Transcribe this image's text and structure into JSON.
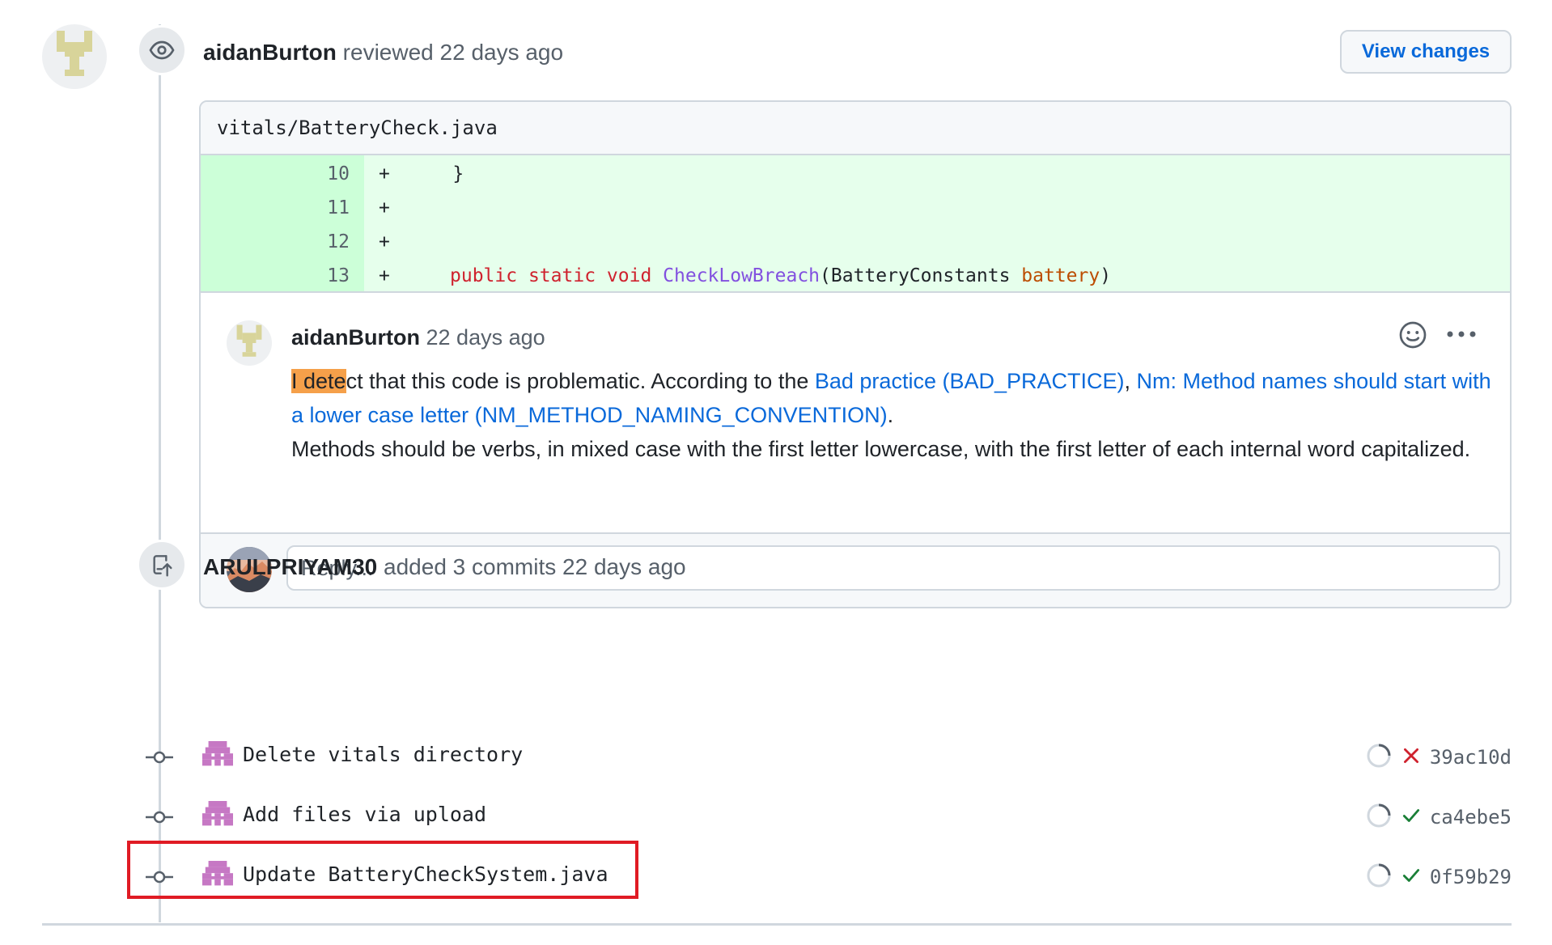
{
  "review": {
    "author": "aidanBurton",
    "action": "reviewed",
    "time": "22 days ago",
    "view_changes_label": "View changes",
    "file_path": "vitals/BatteryCheck.java",
    "diff_lines": [
      {
        "num": "10",
        "sign": "+",
        "code": "    }"
      },
      {
        "num": "11",
        "sign": "+",
        "code": ""
      },
      {
        "num": "12",
        "sign": "+",
        "code": ""
      },
      {
        "num": "13",
        "sign": "+",
        "code_parts": [
          "public",
          "static",
          "void",
          "CheckLowBreach",
          "(BatteryConstants ",
          "battery",
          ")"
        ]
      }
    ],
    "comment": {
      "author": "aidanBurton",
      "time": "22 days ago",
      "text_highlight": "I dete",
      "text_1": "ct that this code is problematic. According to the ",
      "link_1": "Bad practice (BAD_PRACTICE)",
      "sep": ", ",
      "link_2": "Nm: Method names should start with a lower case letter (NM_METHOD_NAMING_CONVENTION)",
      "text_2": ".",
      "text_3": "Methods should be verbs, in mixed case with the first letter lowercase, with the first letter of each internal word capitalized."
    },
    "reply_placeholder": "Reply..."
  },
  "commits_event": {
    "author": "ARULPRIYAM30",
    "action": "added 3 commits",
    "time": "22 days ago",
    "commits": [
      {
        "message": "Delete vitals directory",
        "status": "failure",
        "sha": "39ac10d"
      },
      {
        "message": "Add files via upload",
        "status": "success",
        "sha": "ca4ebe5"
      },
      {
        "message": "Update BatteryCheckSystem.java",
        "status": "success",
        "sha": "0f59b29"
      }
    ]
  },
  "colors": {
    "link": "#0969da",
    "failure": "#cf222e",
    "success": "#1a7f37",
    "highlight_box": "#e01b24",
    "added_line_bg": "#e6ffec"
  }
}
